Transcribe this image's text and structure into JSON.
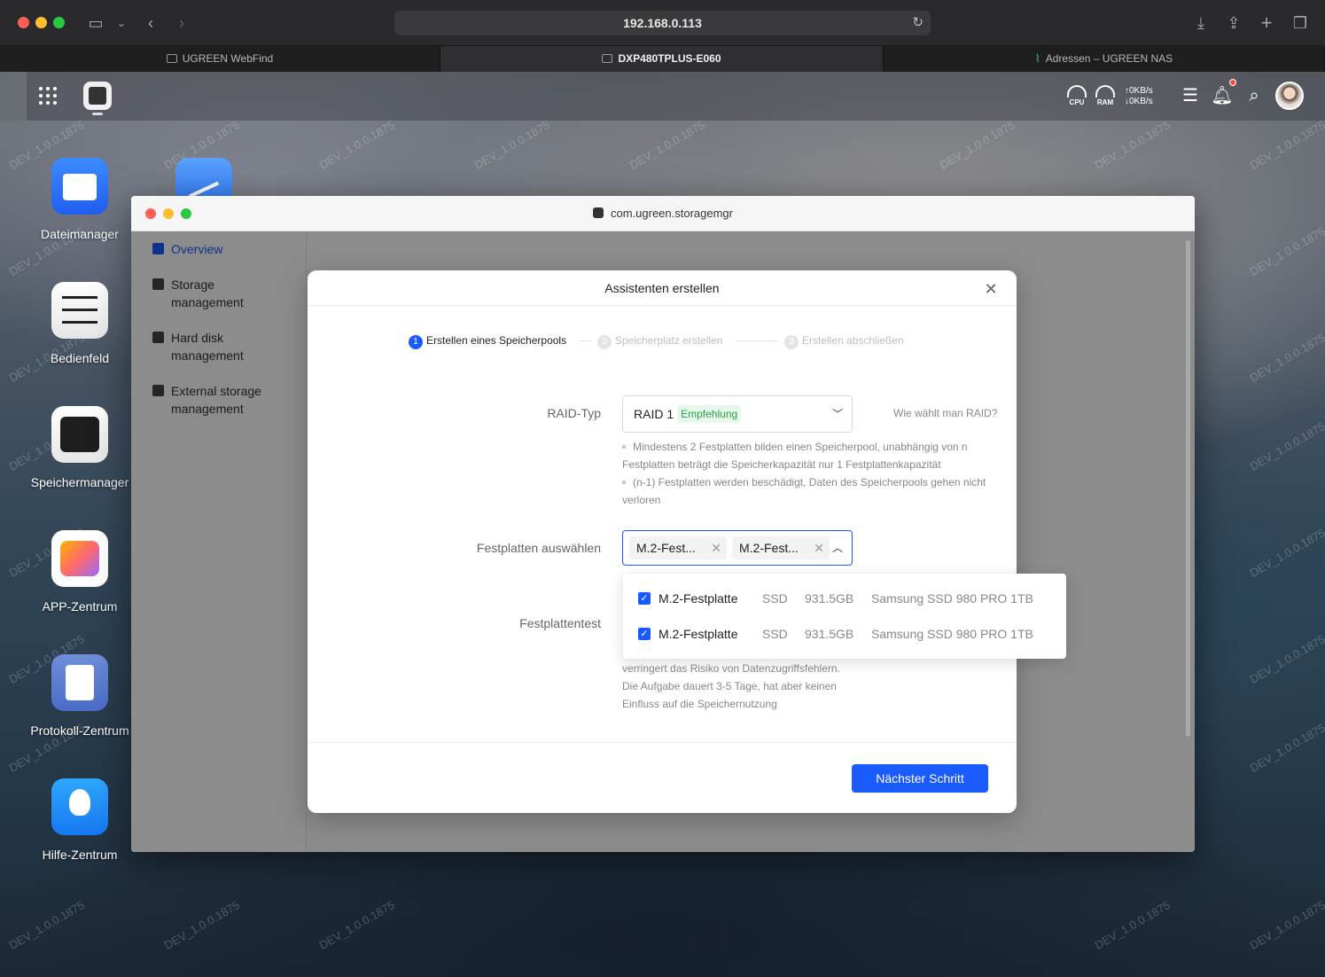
{
  "browser": {
    "address": "192.168.0.113",
    "tabs": [
      {
        "label": "UGREEN WebFind"
      },
      {
        "label": "DXP480TPLUS-E060"
      },
      {
        "label": "Adressen – UGREEN NAS"
      }
    ]
  },
  "nas_bar": {
    "cpu_label": "CPU",
    "ram_label": "RAM",
    "upload": "↑0KB/s",
    "download": "↓0KB/s"
  },
  "watermark": "DEV_1.0.0.1875",
  "desktop_apps": [
    {
      "label": "Dateimanager"
    },
    {
      "label": "Bedienfeld"
    },
    {
      "label": "Speichermanager"
    },
    {
      "label": "APP-Zentrum"
    },
    {
      "label": "Protokoll-Zentrum"
    },
    {
      "label": "Hilfe-Zentrum"
    }
  ],
  "window": {
    "title": "com.ugreen.storagemgr",
    "nav": [
      {
        "label": "Overview"
      },
      {
        "label": "Storage management"
      },
      {
        "label": "Hard disk management"
      },
      {
        "label": "External storage management"
      }
    ]
  },
  "dialog": {
    "title": "Assistenten erstellen",
    "steps": [
      {
        "num": "1",
        "label": "Erstellen eines Speicherpools"
      },
      {
        "num": "2",
        "label": "Speicherplatz erstellen"
      },
      {
        "num": "3",
        "label": "Erstellen abschließen"
      }
    ],
    "raid_label": "RAID-Typ",
    "raid_value": "RAID 1",
    "raid_badge": "Empfehlung",
    "raid_help": "Wie wählt man RAID?",
    "raid_desc_1": "Mindestens 2 Festplatten bilden einen Speicherpool, unabhängig von n Festplatten beträgt die Speicherkapazität nur 1 Festplattenkapazität",
    "raid_desc_2": "(n-1) Festplatten werden beschädigt, Daten des Speicherpools gehen nicht verloren",
    "disks_label": "Festplatten auswählen",
    "chips": [
      {
        "label": "M.2-Fest..."
      },
      {
        "label": "M.2-Fest..."
      }
    ],
    "test_label": "Festplattentest",
    "test_desc": "verringert das Risiko von Datenzugriffsfehlern. Die Aufgabe dauert 3-5 Tage, hat aber keinen Einfluss auf die Speichernutzung",
    "next_button": "Nächster Schritt"
  },
  "disk_options": [
    {
      "name": "M.2-Festplatte",
      "type": "SSD",
      "size": "931.5GB",
      "model": "Samsung SSD 980 PRO 1TB",
      "checked": true
    },
    {
      "name": "M.2-Festplatte",
      "type": "SSD",
      "size": "931.5GB",
      "model": "Samsung SSD 980 PRO 1TB",
      "checked": true
    }
  ],
  "colors": {
    "accent": "#1a5bff",
    "badge_text": "#2aa14a",
    "badge_bg": "#e7f7ea"
  }
}
